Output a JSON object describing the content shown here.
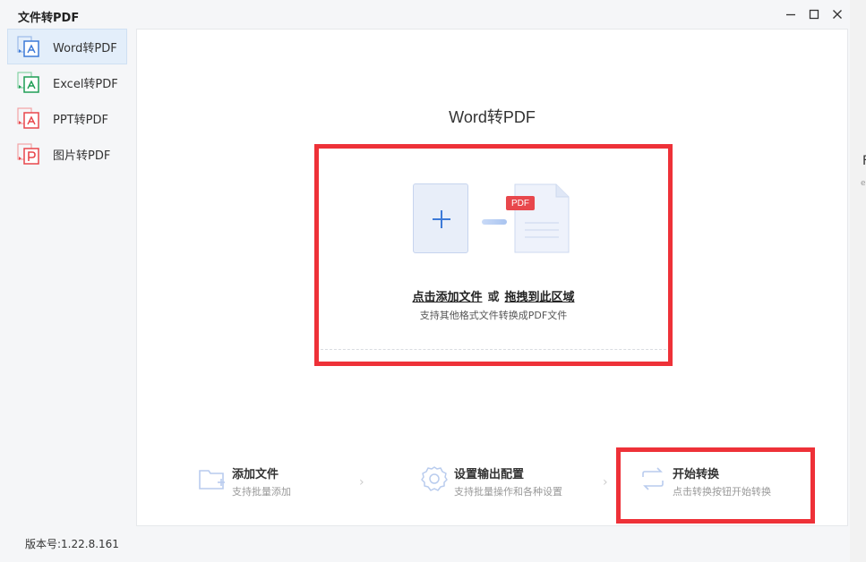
{
  "window": {
    "title": "文件转PDF"
  },
  "sidebar": {
    "items": [
      {
        "label": "Word转PDF",
        "icon": "word-pdf-icon",
        "color": "#3d7ad8",
        "active": true
      },
      {
        "label": "Excel转PDF",
        "icon": "excel-pdf-icon",
        "color": "#1f9d55",
        "active": false
      },
      {
        "label": "PPT转PDF",
        "icon": "ppt-pdf-icon",
        "color": "#e8474c",
        "active": false
      },
      {
        "label": "图片转PDF",
        "icon": "image-pdf-icon",
        "color": "#e8474c",
        "active": false
      }
    ]
  },
  "main": {
    "heading": "Word转PDF",
    "dropzone": {
      "add_files_link": "点击添加文件",
      "or_text": "或",
      "drag_link": "拖拽到此区域",
      "hint": "支持其他格式文件转换成PDF文件",
      "badge": "PDF"
    },
    "steps": [
      {
        "title": "添加文件",
        "desc": "支持批量添加",
        "icon": "folder-add-icon"
      },
      {
        "title": "设置输出配置",
        "desc": "支持批量操作和各种设置",
        "icon": "gear-icon"
      },
      {
        "title": "开始转换",
        "desc": "点击转换按钮开始转换",
        "icon": "convert-icon"
      }
    ]
  },
  "footer": {
    "version": "版本号:1.22.8.161"
  },
  "background_app": {
    "char": "F",
    "sub": "e"
  },
  "colors": {
    "accent": "#3d7ad8",
    "highlight": "#ee3138",
    "active_bg": "#e3eefa"
  }
}
